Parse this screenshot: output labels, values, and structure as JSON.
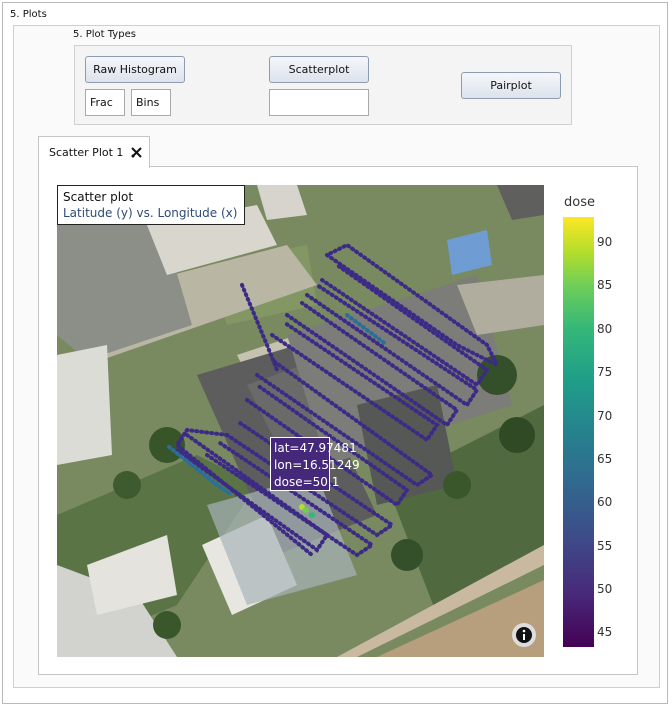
{
  "section": {
    "title": "5. Plots"
  },
  "plot_types": {
    "title": "5. Plot Types",
    "raw_histogram_label": "Raw Histogram",
    "frac_value": "Frac",
    "bins_value": "Bins",
    "scatterplot_label": "Scatterplot",
    "scatter_input_value": "",
    "pairplot_label": "Pairplot"
  },
  "tabs": [
    {
      "label": "Scatter Plot 1"
    }
  ],
  "plot": {
    "title": "Scatter plot",
    "subtitle": "Latitude (y) vs. Longitude (x)",
    "tooltip": {
      "lat": "lat=47.97481",
      "lon": "lon=16.51249",
      "dose": "dose=50.1"
    },
    "colorbar_title": "dose",
    "colorbar_ticks": [
      "90",
      "85",
      "80",
      "75",
      "70",
      "65",
      "60",
      "55",
      "50",
      "45"
    ],
    "background": "satellite-map",
    "colormap": "viridis",
    "point_color": "#3b2a86"
  },
  "chart_data": {
    "type": "scatter",
    "title": "Scatter plot",
    "subtitle": "Latitude (y) vs. Longitude (x)",
    "colorbar": {
      "label": "dose",
      "range": [
        43,
        93
      ],
      "ticks": [
        45,
        50,
        55,
        60,
        65,
        70,
        75,
        80,
        85,
        90
      ]
    },
    "highlight_point": {
      "lat": 47.97481,
      "lon": 16.51249,
      "dose": 50.1
    }
  }
}
